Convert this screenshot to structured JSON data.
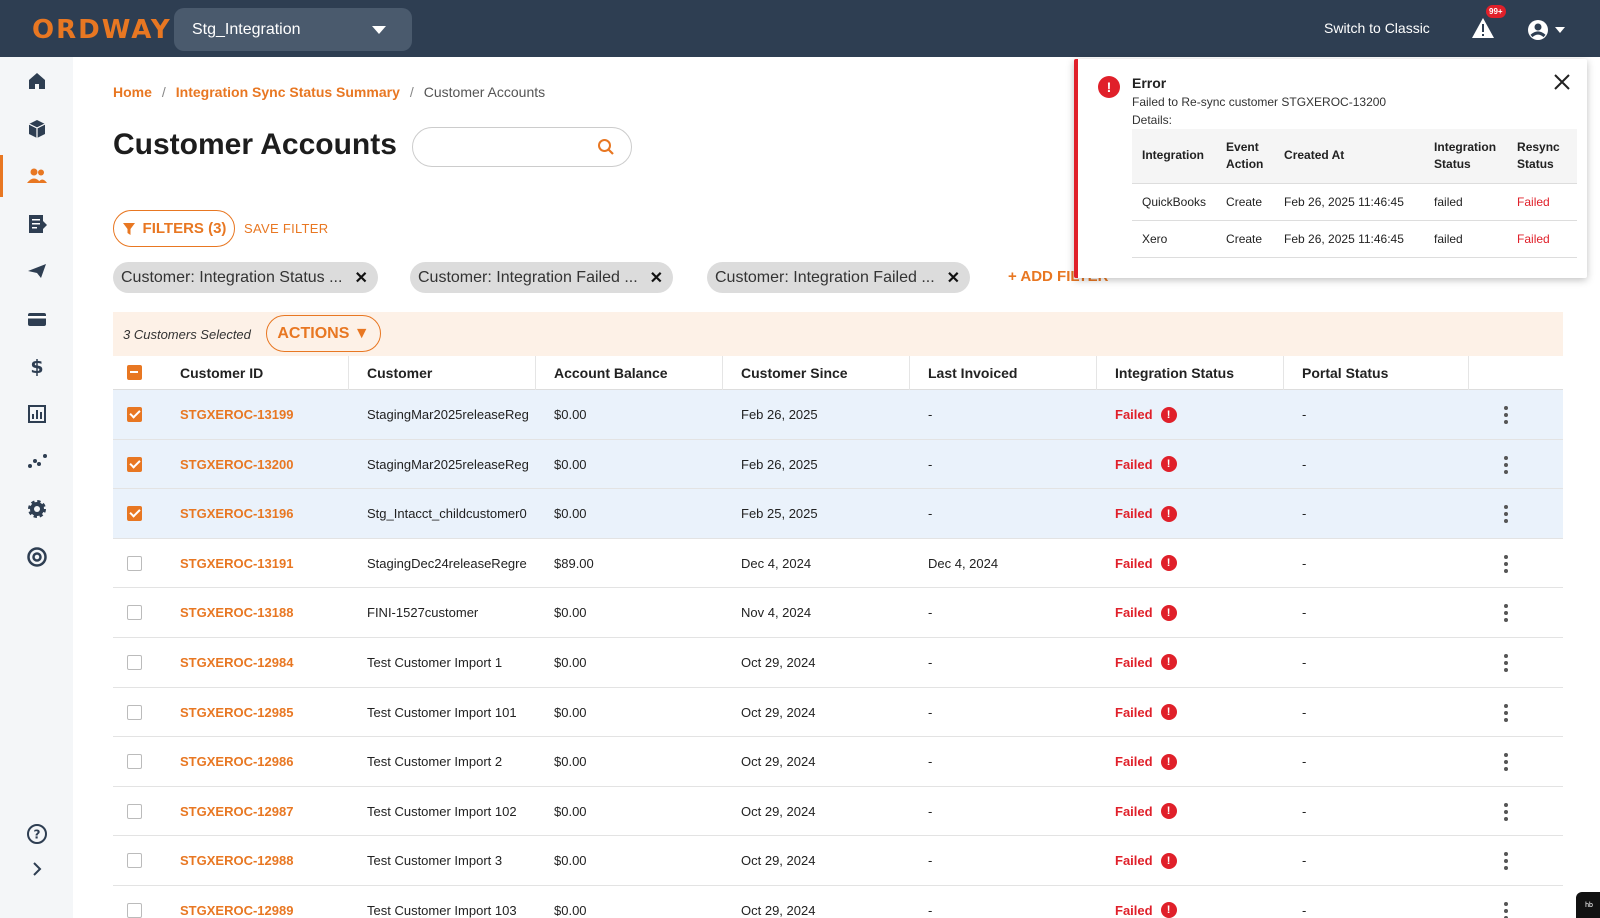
{
  "topbar": {
    "logo": "ORDWAY",
    "environment": "Stg_Integration",
    "switch_classic": "Switch to Classic",
    "alert_badge": "99+"
  },
  "sidebar": {
    "items": [
      {
        "icon": "home-icon"
      },
      {
        "icon": "cube-icon"
      },
      {
        "icon": "customers-icon",
        "active": true
      },
      {
        "icon": "invoice-icon"
      },
      {
        "icon": "send-icon"
      },
      {
        "icon": "card-icon"
      },
      {
        "icon": "dollar-icon"
      },
      {
        "icon": "report-icon"
      },
      {
        "icon": "analytics-icon"
      },
      {
        "icon": "gear-icon"
      },
      {
        "icon": "support-icon"
      }
    ],
    "bottom": [
      {
        "icon": "help-icon"
      },
      {
        "icon": "expand-icon"
      }
    ]
  },
  "breadcrumb": {
    "home": "Home",
    "summary": "Integration Sync Status Summary",
    "current": "Customer Accounts"
  },
  "page_title": "Customer Accounts",
  "search": {
    "value": "",
    "placeholder": ""
  },
  "filters": {
    "button_label": "FILTERS (3)",
    "save_label": "SAVE FILTER",
    "chips": [
      "Customer: Integration Status ...",
      "Customer: Integration Failed ...",
      "Customer: Integration Failed ..."
    ],
    "add_label": "+ ADD FILTER"
  },
  "selection": {
    "text": "3 Customers Selected",
    "actions_label": "ACTIONS ▼"
  },
  "table": {
    "columns": [
      "Customer ID",
      "Customer",
      "Account Balance",
      "Customer Since",
      "Last Invoiced",
      "Integration Status",
      "Portal Status"
    ],
    "rows": [
      {
        "id": "STGXEROC-13199",
        "customer": "StagingMar2025releaseReg",
        "balance": "$0.00",
        "since": "Feb 26, 2025",
        "invoiced": "-",
        "status": "Failed",
        "portal": "-",
        "checked": true
      },
      {
        "id": "STGXEROC-13200",
        "customer": "StagingMar2025releaseReg",
        "balance": "$0.00",
        "since": "Feb 26, 2025",
        "invoiced": "-",
        "status": "Failed",
        "portal": "-",
        "checked": true
      },
      {
        "id": "STGXEROC-13196",
        "customer": "Stg_Intacct_childcustomer0",
        "balance": "$0.00",
        "since": "Feb 25, 2025",
        "invoiced": "-",
        "status": "Failed",
        "portal": "-",
        "checked": true
      },
      {
        "id": "STGXEROC-13191",
        "customer": "StagingDec24releaseRegre",
        "balance": "$89.00",
        "since": "Dec 4, 2024",
        "invoiced": "Dec 4, 2024",
        "status": "Failed",
        "portal": "-",
        "checked": false
      },
      {
        "id": "STGXEROC-13188",
        "customer": "FINI-1527customer",
        "balance": "$0.00",
        "since": "Nov 4, 2024",
        "invoiced": "-",
        "status": "Failed",
        "portal": "-",
        "checked": false
      },
      {
        "id": "STGXEROC-12984",
        "customer": "Test Customer Import 1",
        "balance": "$0.00",
        "since": "Oct 29, 2024",
        "invoiced": "-",
        "status": "Failed",
        "portal": "-",
        "checked": false
      },
      {
        "id": "STGXEROC-12985",
        "customer": "Test Customer Import 101",
        "balance": "$0.00",
        "since": "Oct 29, 2024",
        "invoiced": "-",
        "status": "Failed",
        "portal": "-",
        "checked": false
      },
      {
        "id": "STGXEROC-12986",
        "customer": "Test Customer Import 2",
        "balance": "$0.00",
        "since": "Oct 29, 2024",
        "invoiced": "-",
        "status": "Failed",
        "portal": "-",
        "checked": false
      },
      {
        "id": "STGXEROC-12987",
        "customer": "Test Customer Import 102",
        "balance": "$0.00",
        "since": "Oct 29, 2024",
        "invoiced": "-",
        "status": "Failed",
        "portal": "-",
        "checked": false
      },
      {
        "id": "STGXEROC-12988",
        "customer": "Test Customer Import 3",
        "balance": "$0.00",
        "since": "Oct 29, 2024",
        "invoiced": "-",
        "status": "Failed",
        "portal": "-",
        "checked": false
      },
      {
        "id": "STGXEROC-12989",
        "customer": "Test Customer Import 103",
        "balance": "$0.00",
        "since": "Oct 29, 2024",
        "invoiced": "-",
        "status": "Failed",
        "portal": "-",
        "checked": false
      }
    ]
  },
  "error_toast": {
    "title": "Error",
    "message": "Failed to Re-sync customer STGXEROC-13200",
    "details_label": "Details:",
    "columns": [
      "Integration",
      "Event Action",
      "Created At",
      "Integration Status",
      "Resync Status"
    ],
    "rows": [
      [
        "QuickBooks",
        "Create",
        "Feb 26, 2025 11:46:45",
        "failed",
        "Failed"
      ],
      [
        "Xero",
        "Create",
        "Feb 26, 2025 11:46:45",
        "failed",
        "Failed"
      ]
    ]
  },
  "help_widget": "hb",
  "colors": {
    "accent": "#e87722",
    "header": "#2e3e52",
    "error": "#e0202a",
    "selected_row": "#eaf2fb"
  }
}
